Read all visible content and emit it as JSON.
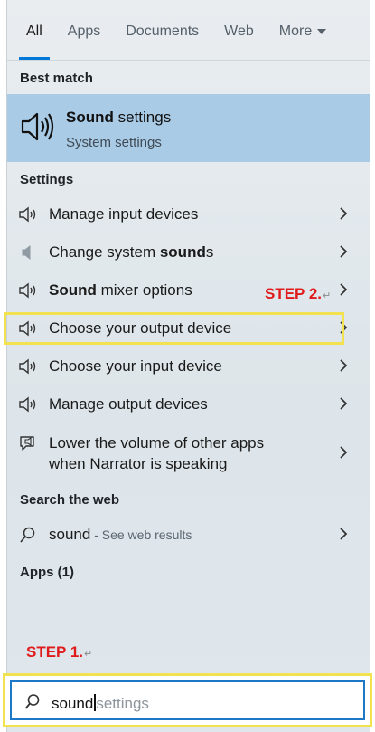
{
  "tabs": [
    {
      "label": "All"
    },
    {
      "label": "Apps"
    },
    {
      "label": "Documents"
    },
    {
      "label": "Web"
    },
    {
      "label": "More"
    }
  ],
  "best_match": {
    "header": "Best match",
    "title_bold": "Sound",
    "title_rest": " settings",
    "subtitle": "System settings"
  },
  "settings": {
    "header": "Settings",
    "items": [
      {
        "pre": "",
        "bold": "",
        "post": "Manage input devices"
      },
      {
        "pre": "Change system ",
        "bold": "sound",
        "post": "s"
      },
      {
        "pre": "",
        "bold": "Sound",
        "post": " mixer options"
      },
      {
        "pre": "",
        "bold": "",
        "post": "Choose your output device"
      },
      {
        "pre": "",
        "bold": "",
        "post": "Choose your input device"
      },
      {
        "pre": "",
        "bold": "",
        "post": "Manage output devices"
      },
      {
        "line1": "Lower the volume of other apps",
        "line2": "when Narrator is speaking"
      }
    ]
  },
  "web": {
    "header": "Search the web",
    "query": "sound",
    "suffix": " - See web results"
  },
  "apps_header": "Apps (1)",
  "annotations": {
    "step1": "STEP 1.",
    "step2": "STEP 2.",
    "return_mark": "↵"
  },
  "search": {
    "typed": "sound",
    "suggestion": "settings"
  },
  "colors": {
    "accent": "#0078d7",
    "best_match_bg": "#a9cbe6",
    "highlight": "#f3e24f",
    "step_text": "#e01b1b"
  }
}
